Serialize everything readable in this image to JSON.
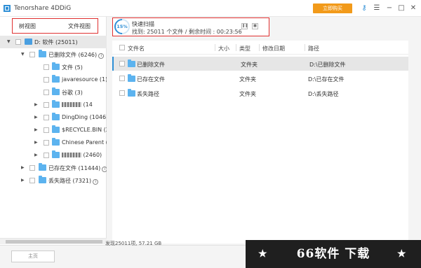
{
  "titlebar": {
    "app_title": "Tenorshare 4DDiG",
    "buy_label": "立即购买",
    "icons": [
      "key-icon",
      "menu-icon",
      "minimize-icon",
      "restore-icon",
      "close-icon"
    ],
    "accent_color": "#2e8fd6",
    "buy_color": "#f29a1a"
  },
  "left_panel": {
    "tabs": [
      "树视图",
      "文件视图"
    ],
    "tree": {
      "root": "D: 软件 (25011)",
      "deleted": "已删除文件 (6246)",
      "children": [
        "文件 (5)",
        "javaresource (1)",
        "谷歌 (3)",
        "(14",
        "DingDing (1046)",
        "$RECYCLE.BIN (2",
        "Chinese Parent (",
        "(2460)"
      ],
      "existing": "已存在文件 (11444)",
      "lost": "丢失路径 (7321)"
    }
  },
  "scan": {
    "percent": "15%",
    "progress_fraction": 0.15,
    "title": "快速扫描",
    "info": "找到: 25011 个文件  /  剩余时间 : 00:23:56"
  },
  "table": {
    "columns": [
      "文件名",
      "大小",
      "类型",
      "修改日期",
      "路径"
    ],
    "rows": [
      {
        "name": "已删除文件",
        "size": "",
        "type": "文件夹",
        "date": "",
        "path": "D:\\已删除文件"
      },
      {
        "name": "已存在文件",
        "size": "",
        "type": "文件夹",
        "date": "",
        "path": "D:\\已存在文件"
      },
      {
        "name": "丢失路径",
        "size": "",
        "type": "文件夹",
        "date": "",
        "path": "D:\\丢失路径"
      }
    ]
  },
  "footer": {
    "home_label": "主页",
    "status": "发现25011项, 57.21 GB",
    "watermark": "66软件 下载"
  }
}
